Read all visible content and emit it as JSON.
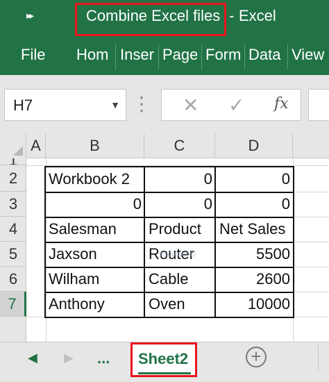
{
  "titlebar": {
    "qat_icon": "fast-forward-icon",
    "qat_glyph": "▸▸",
    "file_name": "Combine Excel files",
    "separator": "-",
    "app_name": "Excel"
  },
  "ribbon": {
    "tabs": [
      {
        "label": "File"
      },
      {
        "label": "Hom"
      },
      {
        "label": "Inser"
      },
      {
        "label": "Page"
      },
      {
        "label": "Form"
      },
      {
        "label": "Data"
      },
      {
        "label": "View"
      }
    ]
  },
  "formula_bar": {
    "name_box_value": "H7",
    "dropdown_icon": "chevron-down-icon",
    "dropdown_glyph": "▼",
    "separator_glyph": "⋮",
    "cancel_glyph": "✕",
    "enter_glyph": "✓",
    "fx_label": "fx"
  },
  "grid": {
    "columns": [
      "A",
      "B",
      "C",
      "D"
    ],
    "rows": [
      "1",
      "2",
      "3",
      "4",
      "5",
      "6",
      "7"
    ],
    "active_row": "7",
    "cells": [
      [
        "Workbook 2",
        "0",
        "0"
      ],
      [
        "0",
        "0",
        "0"
      ],
      [
        "Salesman",
        "Product",
        "Net Sales"
      ],
      [
        "Jaxson",
        "Router",
        "5500"
      ],
      [
        "Wilham",
        "Cable",
        "2600"
      ],
      [
        "Anthony",
        "Oven",
        "10000"
      ]
    ],
    "watermark": "exceldemy"
  },
  "sheet_bar": {
    "prev_glyph": "◀",
    "next_glyph": "▶",
    "more_label": "...",
    "active_sheet": "Sheet2",
    "add_glyph": "+"
  },
  "colors": {
    "excel_green": "#217346",
    "highlight_red": "#e8141c"
  }
}
